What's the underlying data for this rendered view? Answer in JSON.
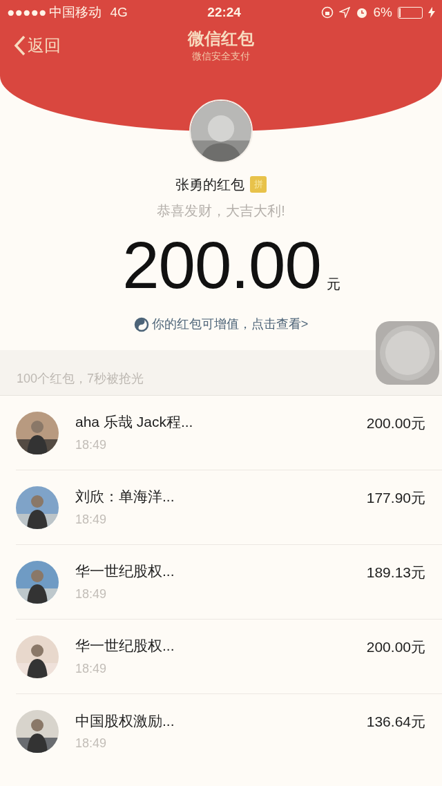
{
  "status_bar": {
    "signal_dots": "●●●●●",
    "carrier": "中国移动",
    "network": "4G",
    "time": "22:24",
    "battery_percent": "6%"
  },
  "nav": {
    "back": "返回",
    "title": "微信红包",
    "subtitle": "微信安全支付"
  },
  "envelope": {
    "sender": "张勇的红包",
    "badge": "拼",
    "greeting": "恭喜发财，大吉大利!",
    "amount": "200.00",
    "unit": "元",
    "link": "你的红包可增值，点击查看>"
  },
  "summary": "100个红包，7秒被抢光",
  "claims": [
    {
      "name": "aha 乐哉 Jack程...",
      "time": "18:49",
      "amount": "200.00元"
    },
    {
      "name": "刘欣：单海洋...",
      "time": "18:49",
      "amount": "177.90元"
    },
    {
      "name": "华一世纪股权...",
      "time": "18:49",
      "amount": "189.13元"
    },
    {
      "name": "华一世纪股权...",
      "time": "18:49",
      "amount": "200.00元"
    },
    {
      "name": "中国股权激励...",
      "time": "18:49",
      "amount": "136.64元"
    }
  ]
}
